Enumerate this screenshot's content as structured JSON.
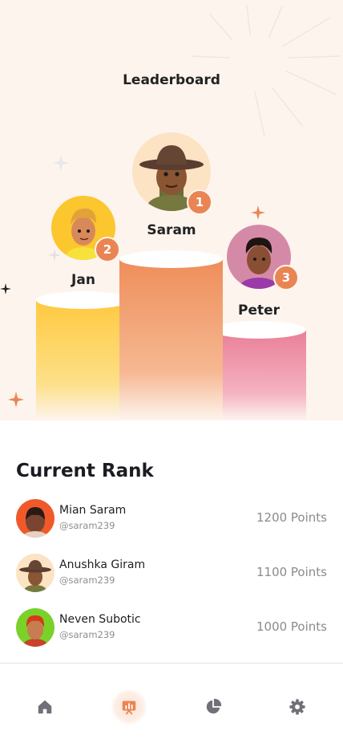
{
  "header": {
    "title": "Leaderboard"
  },
  "podium": [
    {
      "rank": "1",
      "name": "Saram",
      "color": "#ee8e5a"
    },
    {
      "rank": "2",
      "name": "Jan",
      "color": "#fec93e"
    },
    {
      "rank": "3",
      "name": "Peter",
      "color": "#ea7e97"
    }
  ],
  "current_rank": {
    "title": "Current Rank",
    "rows": [
      {
        "name": "Mian Saram",
        "handle": "@saram239",
        "points": "1200 Points"
      },
      {
        "name": "Anushka Giram",
        "handle": "@saram239",
        "points": "1100 Points"
      },
      {
        "name": "Neven Subotic",
        "handle": "@saram239",
        "points": "1000 Points"
      }
    ]
  },
  "nav": {
    "items": [
      {
        "icon": "home-icon",
        "active": false
      },
      {
        "icon": "leaderboard-icon",
        "active": true
      },
      {
        "icon": "pie-chart-icon",
        "active": false
      },
      {
        "icon": "settings-icon",
        "active": false
      }
    ],
    "accent": "#e98553",
    "inactive": "#707078"
  }
}
